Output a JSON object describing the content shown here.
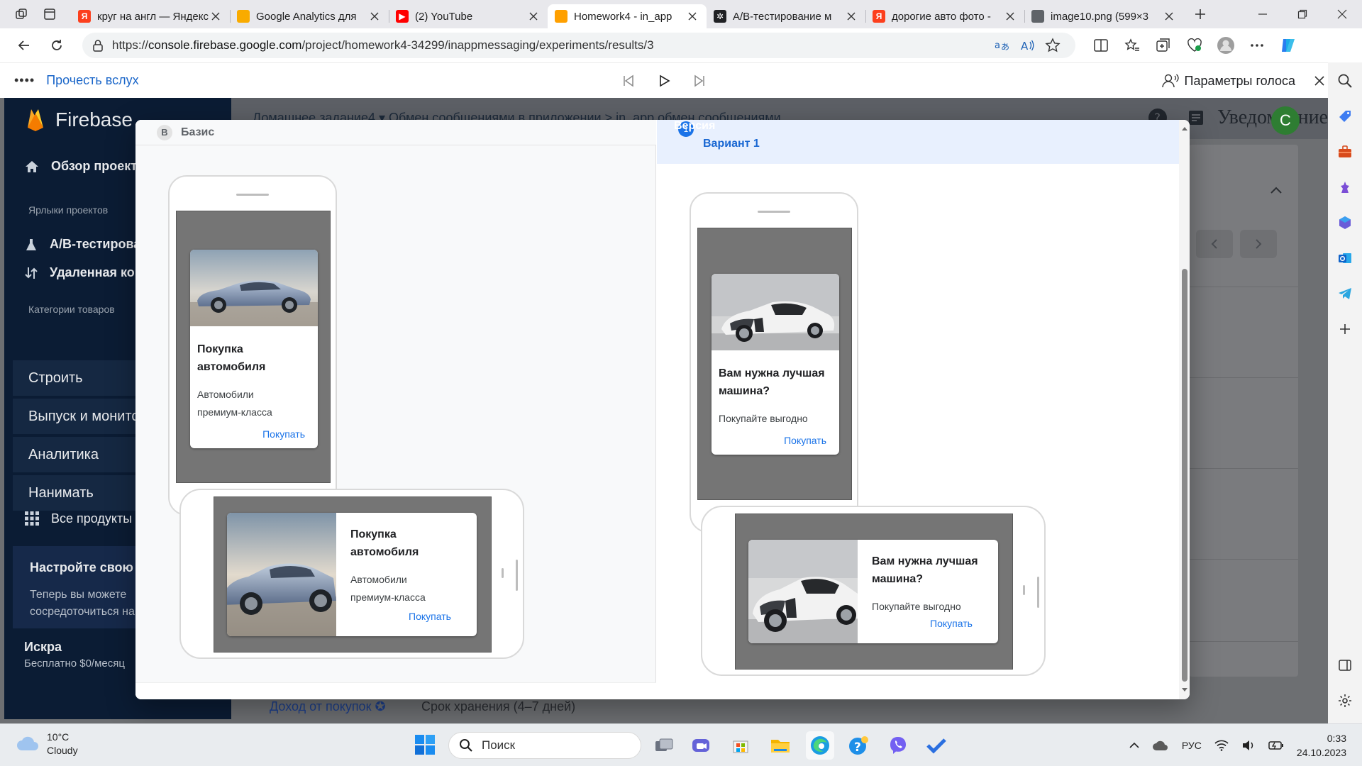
{
  "browser": {
    "tabs": [
      {
        "title": "круг на англ — Яндекс",
        "favicon": "yandex-icon",
        "color": "#fc3f1d",
        "glyph": "Я"
      },
      {
        "title": "Google Analytics для",
        "favicon": "firebase-icon",
        "color": "#f9ab00",
        "glyph": ""
      },
      {
        "title": "(2) YouTube",
        "favicon": "youtube-icon",
        "color": "#ff0000",
        "glyph": "▶"
      },
      {
        "title": "Homework4 - in_app",
        "favicon": "firebase-icon",
        "color": "#ffa000",
        "glyph": "",
        "active": true
      },
      {
        "title": "A/B-тестирование м",
        "favicon": "openai-icon",
        "color": "#202124",
        "glyph": "✲"
      },
      {
        "title": "дорогие авто фото -",
        "favicon": "yandex-icon",
        "color": "#fc3f1d",
        "glyph": "Я"
      },
      {
        "title": "image10.png (599×3",
        "favicon": "file-icon",
        "color": "#5f6368",
        "glyph": ""
      }
    ],
    "url_prefix": "https://",
    "url_host": "console.firebase.google.com",
    "url_path": "/project/homework4-34299/inappmessaging/experiments/results/3"
  },
  "reader": {
    "read_aloud_label": "Прочесть вслух",
    "voice_settings_label": "Параметры голоса"
  },
  "firebase": {
    "brand": "Firebase",
    "project_overview": "Обзор проекта",
    "shortcuts_caption": "Ярлыки проектов",
    "shortcut_ab": "A/B-тестирование",
    "shortcut_remote": "Удаленная конфигурация",
    "categories_caption": "Категории товаров",
    "sections": [
      "Строить",
      "Выпуск и монито",
      "Аналитика",
      "Нанимать"
    ],
    "all_products": "Все продукты",
    "promo_title": "Настройте свою на",
    "promo_text_1": "Теперь вы можете",
    "promo_text_2": "сосредоточиться на",
    "plan_name": "Искра",
    "plan_desc": "Бесплатно $0/месяц",
    "breadcrumb": "Домашнее задание4 ▾    Обмен сообщениями в приложении  >  in_app обмен сообщениями",
    "notifications_label": "Уведомление",
    "avatar_letter": "С",
    "bottom_tab_revenue": "Доход от покупок",
    "bottom_tab_retention": "Срок хранения (4–7 дней)"
  },
  "modal": {
    "baseline": {
      "chip": "B",
      "label": "Базис",
      "title_line1": "Покупка",
      "title_line2": "автомобиля",
      "body_line1": "Автомобили",
      "body_line2": "премиум-класса",
      "action": "Покупать"
    },
    "variant": {
      "tag": "Версия",
      "chip": "1",
      "label": "Вариант 1",
      "title_line1": "Вам нужна лучшая",
      "title_line2": "машина?",
      "body_line1": "Покупайте выгодно",
      "action": "Покупать"
    }
  },
  "taskbar": {
    "temperature": "10°C",
    "condition": "Cloudy",
    "search_placeholder": "Поиск",
    "language": "РУС",
    "time": "0:33",
    "date": "24.10.2023"
  }
}
